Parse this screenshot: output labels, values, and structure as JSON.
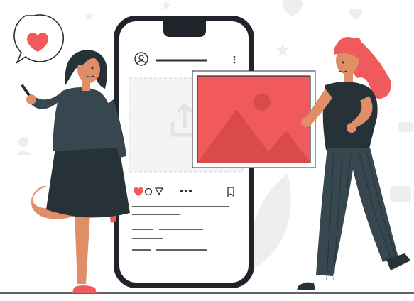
{
  "palette": {
    "accent": "#F15A5C",
    "dark": "#263238",
    "skin": "#E08E68",
    "sock": "#F15A5C",
    "decor": "#EBEBEB",
    "phone_frame": "#1E2429"
  },
  "icons": [
    "heart-icon",
    "star-icon",
    "user-avatar-icon",
    "more-dots-icon",
    "upload-arrow-icon",
    "image-placeholder-icon",
    "comment-icon",
    "send-icon",
    "bookmark-icon",
    "chat-bubble-icon",
    "leaf-icon"
  ],
  "post": {
    "has_caption": true,
    "liked": true
  }
}
